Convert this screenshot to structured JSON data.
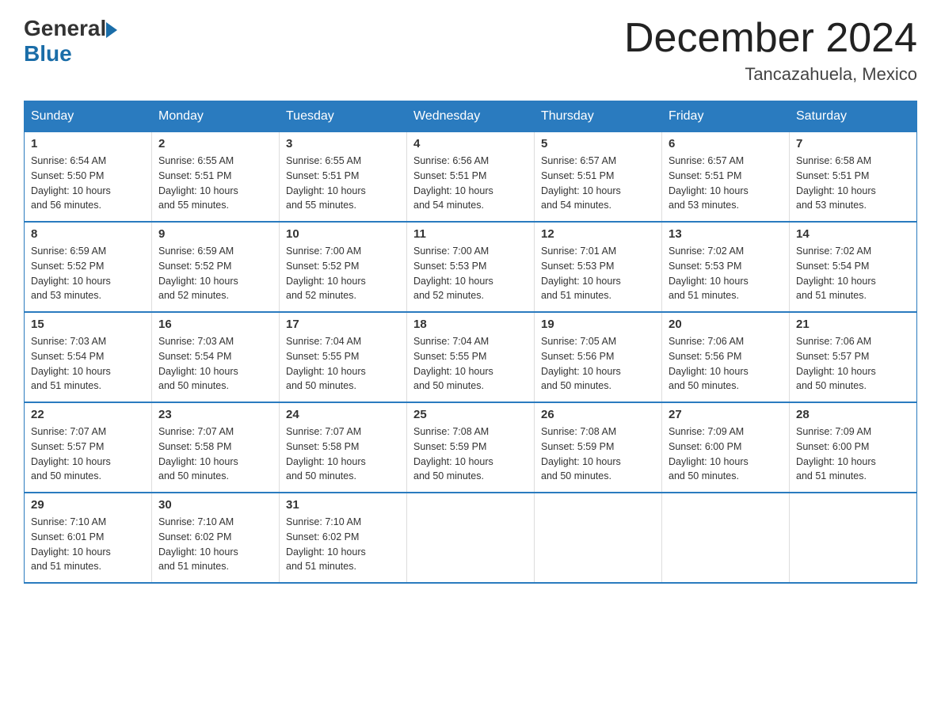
{
  "logo": {
    "general": "General",
    "blue": "Blue"
  },
  "title": {
    "month_year": "December 2024",
    "location": "Tancazahuela, Mexico"
  },
  "days_of_week": [
    "Sunday",
    "Monday",
    "Tuesday",
    "Wednesday",
    "Thursday",
    "Friday",
    "Saturday"
  ],
  "weeks": [
    [
      {
        "day": "1",
        "sunrise": "6:54 AM",
        "sunset": "5:50 PM",
        "daylight": "10 hours and 56 minutes."
      },
      {
        "day": "2",
        "sunrise": "6:55 AM",
        "sunset": "5:51 PM",
        "daylight": "10 hours and 55 minutes."
      },
      {
        "day": "3",
        "sunrise": "6:55 AM",
        "sunset": "5:51 PM",
        "daylight": "10 hours and 55 minutes."
      },
      {
        "day": "4",
        "sunrise": "6:56 AM",
        "sunset": "5:51 PM",
        "daylight": "10 hours and 54 minutes."
      },
      {
        "day": "5",
        "sunrise": "6:57 AM",
        "sunset": "5:51 PM",
        "daylight": "10 hours and 54 minutes."
      },
      {
        "day": "6",
        "sunrise": "6:57 AM",
        "sunset": "5:51 PM",
        "daylight": "10 hours and 53 minutes."
      },
      {
        "day": "7",
        "sunrise": "6:58 AM",
        "sunset": "5:51 PM",
        "daylight": "10 hours and 53 minutes."
      }
    ],
    [
      {
        "day": "8",
        "sunrise": "6:59 AM",
        "sunset": "5:52 PM",
        "daylight": "10 hours and 53 minutes."
      },
      {
        "day": "9",
        "sunrise": "6:59 AM",
        "sunset": "5:52 PM",
        "daylight": "10 hours and 52 minutes."
      },
      {
        "day": "10",
        "sunrise": "7:00 AM",
        "sunset": "5:52 PM",
        "daylight": "10 hours and 52 minutes."
      },
      {
        "day": "11",
        "sunrise": "7:00 AM",
        "sunset": "5:53 PM",
        "daylight": "10 hours and 52 minutes."
      },
      {
        "day": "12",
        "sunrise": "7:01 AM",
        "sunset": "5:53 PM",
        "daylight": "10 hours and 51 minutes."
      },
      {
        "day": "13",
        "sunrise": "7:02 AM",
        "sunset": "5:53 PM",
        "daylight": "10 hours and 51 minutes."
      },
      {
        "day": "14",
        "sunrise": "7:02 AM",
        "sunset": "5:54 PM",
        "daylight": "10 hours and 51 minutes."
      }
    ],
    [
      {
        "day": "15",
        "sunrise": "7:03 AM",
        "sunset": "5:54 PM",
        "daylight": "10 hours and 51 minutes."
      },
      {
        "day": "16",
        "sunrise": "7:03 AM",
        "sunset": "5:54 PM",
        "daylight": "10 hours and 50 minutes."
      },
      {
        "day": "17",
        "sunrise": "7:04 AM",
        "sunset": "5:55 PM",
        "daylight": "10 hours and 50 minutes."
      },
      {
        "day": "18",
        "sunrise": "7:04 AM",
        "sunset": "5:55 PM",
        "daylight": "10 hours and 50 minutes."
      },
      {
        "day": "19",
        "sunrise": "7:05 AM",
        "sunset": "5:56 PM",
        "daylight": "10 hours and 50 minutes."
      },
      {
        "day": "20",
        "sunrise": "7:06 AM",
        "sunset": "5:56 PM",
        "daylight": "10 hours and 50 minutes."
      },
      {
        "day": "21",
        "sunrise": "7:06 AM",
        "sunset": "5:57 PM",
        "daylight": "10 hours and 50 minutes."
      }
    ],
    [
      {
        "day": "22",
        "sunrise": "7:07 AM",
        "sunset": "5:57 PM",
        "daylight": "10 hours and 50 minutes."
      },
      {
        "day": "23",
        "sunrise": "7:07 AM",
        "sunset": "5:58 PM",
        "daylight": "10 hours and 50 minutes."
      },
      {
        "day": "24",
        "sunrise": "7:07 AM",
        "sunset": "5:58 PM",
        "daylight": "10 hours and 50 minutes."
      },
      {
        "day": "25",
        "sunrise": "7:08 AM",
        "sunset": "5:59 PM",
        "daylight": "10 hours and 50 minutes."
      },
      {
        "day": "26",
        "sunrise": "7:08 AM",
        "sunset": "5:59 PM",
        "daylight": "10 hours and 50 minutes."
      },
      {
        "day": "27",
        "sunrise": "7:09 AM",
        "sunset": "6:00 PM",
        "daylight": "10 hours and 50 minutes."
      },
      {
        "day": "28",
        "sunrise": "7:09 AM",
        "sunset": "6:00 PM",
        "daylight": "10 hours and 51 minutes."
      }
    ],
    [
      {
        "day": "29",
        "sunrise": "7:10 AM",
        "sunset": "6:01 PM",
        "daylight": "10 hours and 51 minutes."
      },
      {
        "day": "30",
        "sunrise": "7:10 AM",
        "sunset": "6:02 PM",
        "daylight": "10 hours and 51 minutes."
      },
      {
        "day": "31",
        "sunrise": "7:10 AM",
        "sunset": "6:02 PM",
        "daylight": "10 hours and 51 minutes."
      },
      null,
      null,
      null,
      null
    ]
  ],
  "labels": {
    "sunrise": "Sunrise:",
    "sunset": "Sunset:",
    "daylight": "Daylight:"
  }
}
